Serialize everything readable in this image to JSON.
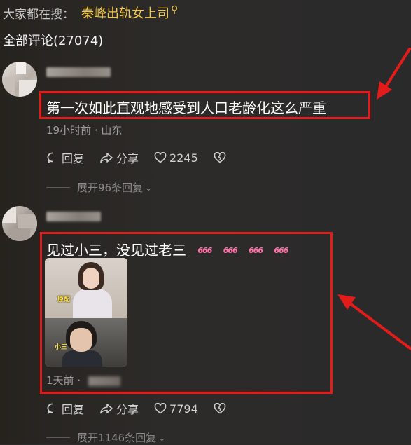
{
  "search": {
    "prefix": "大家都在搜：",
    "topic": "秦峰出轨女上司",
    "icon": "search-icon"
  },
  "comments_header": "全部评论(27074)",
  "comments": [
    {
      "text": "第一次如此直观地感受到人口老龄化这么严重",
      "time": "19小时前",
      "location": "山东",
      "reply_label": "回复",
      "share_label": "分享",
      "likes": "2245",
      "expand": "展开96条回复"
    },
    {
      "text": "见过小三，没见过老三",
      "emoji": [
        "666",
        "666",
        "666",
        "666"
      ],
      "meme_labels": [
        "原配",
        "小三"
      ],
      "time": "1天前",
      "reply_label": "回复",
      "share_label": "分享",
      "likes": "7794",
      "expand": "展开1146条回复"
    }
  ],
  "colors": {
    "background": "#2b2a28",
    "highlight": "#e21b1b",
    "accent": "#f2c94c"
  }
}
